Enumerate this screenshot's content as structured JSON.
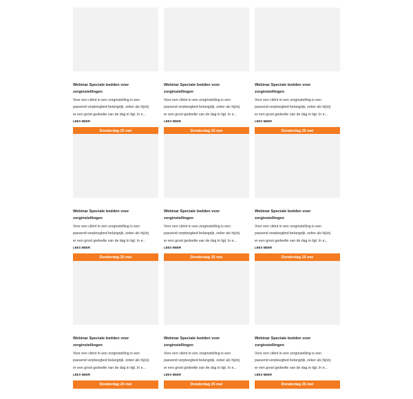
{
  "cards": [
    {
      "title": "Webinar Speciale bedden voor zorginstellingen",
      "excerpt_lines": [
        "Voor een cliënt in een zorginstelling is een",
        "passend verpleegbed belangrijk, zeker als hij/zij",
        "er een groot gedeelte van de dag in ligt. In e..."
      ],
      "more_label": "LEES MEER",
      "date_label": "Donderdag 25 mei"
    },
    {
      "title": "Webinar Speciale bedden voor zorginstellingen",
      "excerpt_lines": [
        "Voor een cliënt in een zorginstelling is een",
        "passend verpleegbed belangrijk, zeker als hij/zij",
        "er een groot gedeelte van de dag in ligt. In e..."
      ],
      "more_label": "LEES MEER",
      "date_label": "Donderdag 25 mei"
    },
    {
      "title": "Webinar Speciale bedden voor zorginstellingen",
      "excerpt_lines": [
        "Voor een cliënt in een zorginstelling is een",
        "passend verpleegbed belangrijk, zeker als hij/zij",
        "er een groot gedeelte van de dag in ligt. In e..."
      ],
      "more_label": "LEES MEER",
      "date_label": "Donderdag 25 mei"
    },
    {
      "title": "Webinar Speciale bedden voor zorginstellingen",
      "excerpt_lines": [
        "Voor een cliënt in een zorginstelling is een",
        "passend verpleegbed belangrijk, zeker als hij/zij",
        "er een groot gedeelte van de dag in ligt. In e..."
      ],
      "more_label": "LEES MEER",
      "date_label": "Donderdag 25 mei"
    },
    {
      "title": "Webinar Speciale bedden voor zorginstellingen",
      "excerpt_lines": [
        "Voor een cliënt in een zorginstelling is een",
        "passend verpleegbed belangrijk, zeker als hij/zij",
        "er een groot gedeelte van de dag in ligt. In e..."
      ],
      "more_label": "LEES MEER",
      "date_label": "Donderdag 25 mei"
    },
    {
      "title": "Webinar Speciale bedden voor zorginstellingen",
      "excerpt_lines": [
        "Voor een cliënt in een zorginstelling is een",
        "passend verpleegbed belangrijk, zeker als hij/zij",
        "er een groot gedeelte van de dag in ligt. In e..."
      ],
      "more_label": "LEES MEER",
      "date_label": "Donderdag 25 mei"
    },
    {
      "title": "Webinar Speciale bedden voor zorginstellingen",
      "excerpt_lines": [
        "Voor een cliënt in een zorginstelling is een",
        "passend verpleegbed belangrijk, zeker als hij/zij",
        "er een groot gedeelte van de dag in ligt. In e..."
      ],
      "more_label": "LEES MEER",
      "date_label": "Donderdag 25 mei"
    },
    {
      "title": "Webinar Speciale bedden voor zorginstellingen",
      "excerpt_lines": [
        "Voor een cliënt in een zorginstelling is een",
        "passend verpleegbed belangrijk, zeker als hij/zij",
        "er een groot gedeelte van de dag in ligt. In e..."
      ],
      "more_label": "LEES MEER",
      "date_label": "Donderdag 25 mei"
    },
    {
      "title": "Webinar Speciale bedden voor zorginstellingen",
      "excerpt_lines": [
        "Voor een cliënt in een zorginstelling is een",
        "passend verpleegbed belangrijk, zeker als hij/zij",
        "er een groot gedeelte van de dag in ligt. In e..."
      ],
      "more_label": "LEES MEER",
      "date_label": "Donderdag 25 mei"
    }
  ],
  "colors": {
    "accent": "#f47b20",
    "thumbnail_placeholder": "#f2f2f2",
    "background": "#ffffff"
  }
}
